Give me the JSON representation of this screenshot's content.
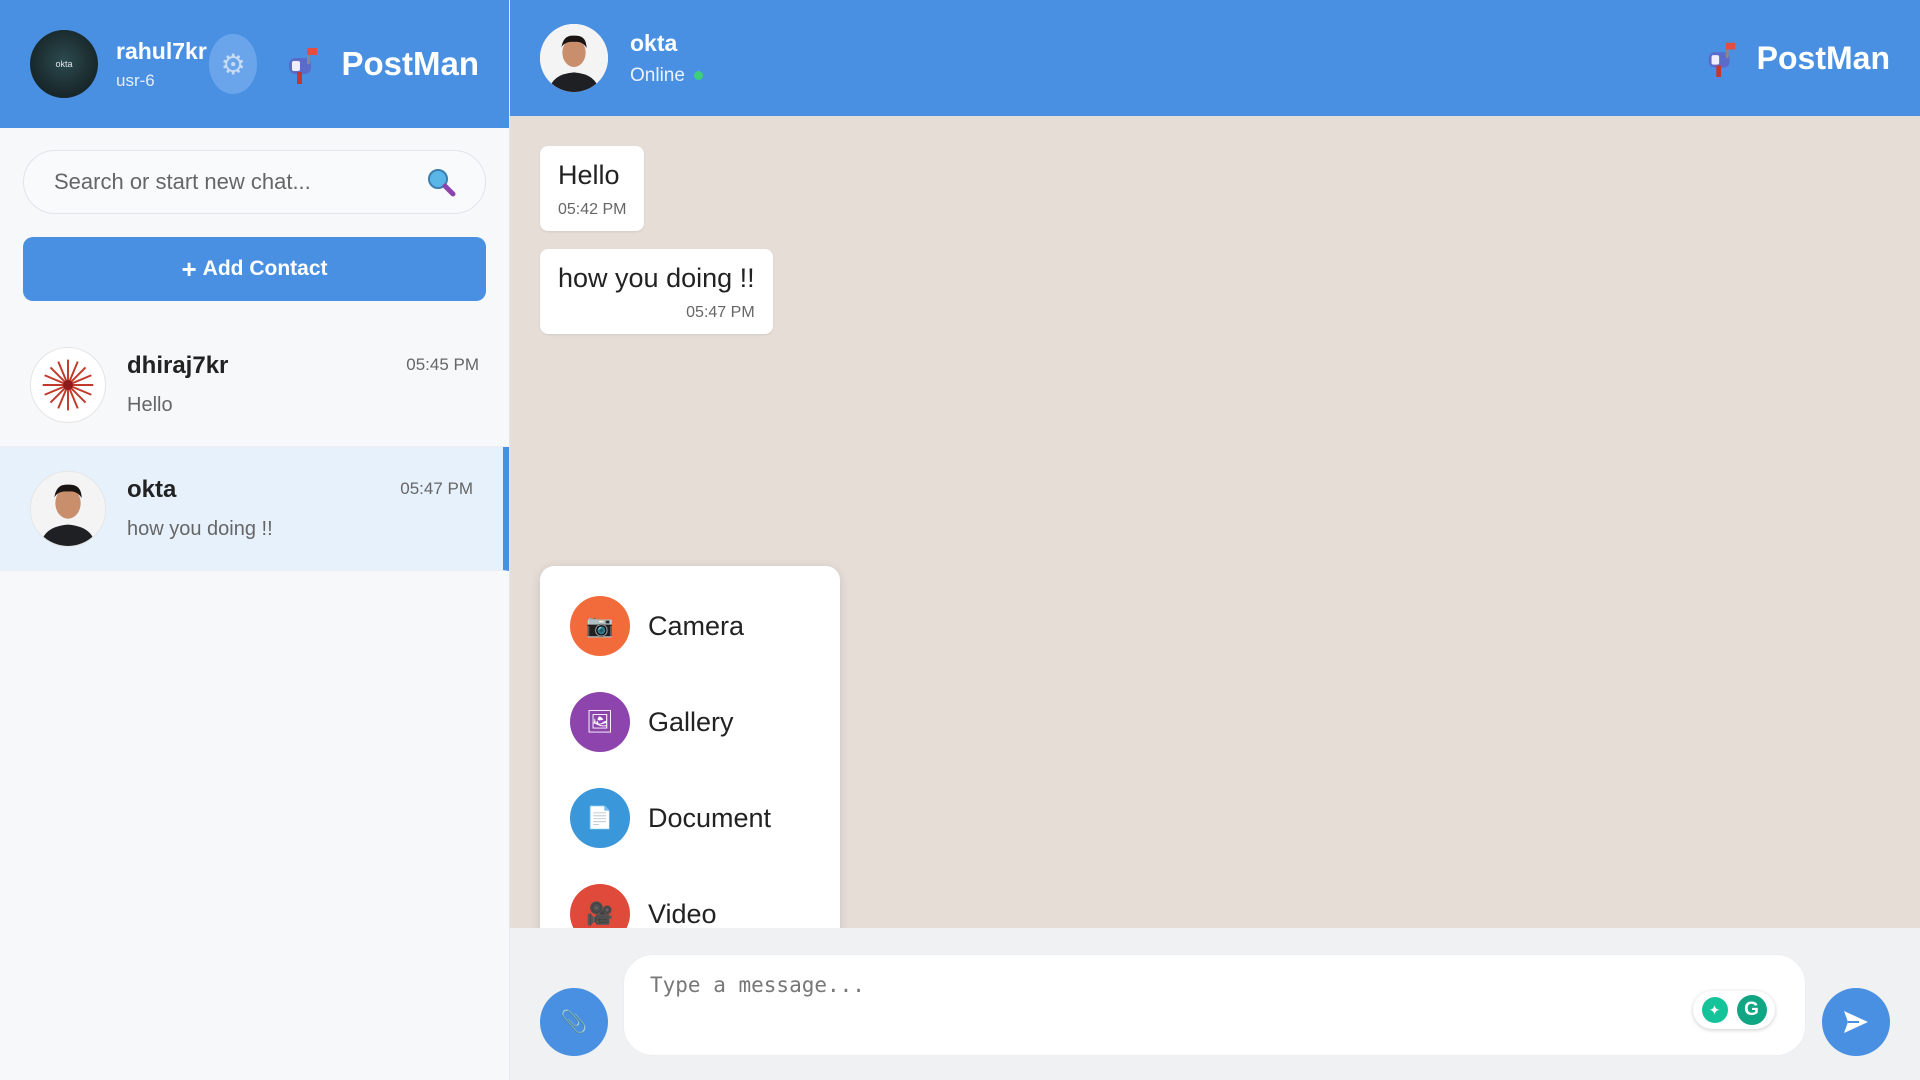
{
  "me": {
    "name": "rahul7kr",
    "id": "usr-6",
    "avatar_text": "okta"
  },
  "brand": {
    "name": "PostMan"
  },
  "search": {
    "placeholder": "Search or start new chat..."
  },
  "add_contact": {
    "label": "Add Contact",
    "icon": "plus-icon"
  },
  "chats": [
    {
      "name": "dhiraj7kr",
      "preview": "Hello",
      "time": "05:45 PM",
      "active": false
    },
    {
      "name": "okta",
      "preview": "how you doing !!",
      "time": "05:47 PM",
      "active": true
    }
  ],
  "conversation": {
    "contact_name": "okta",
    "status": "Online",
    "messages": [
      {
        "text": "Hello",
        "time": "05:42 PM"
      },
      {
        "text": "how you doing !!",
        "time": "05:47 PM"
      }
    ]
  },
  "attach_menu": [
    {
      "label": "Camera",
      "icon": "camera-icon",
      "color": "#f26b3a"
    },
    {
      "label": "Gallery",
      "icon": "gallery-icon",
      "color": "#8e44ad"
    },
    {
      "label": "Document",
      "icon": "document-icon",
      "color": "#3a97d9"
    },
    {
      "label": "Video",
      "icon": "video-icon",
      "color": "#e04a3b"
    }
  ],
  "composer": {
    "placeholder": "Type a message..."
  },
  "colors": {
    "primary": "#4a90e2",
    "chat_bg": "#e5ddd6",
    "online": "#3ecf7a"
  }
}
